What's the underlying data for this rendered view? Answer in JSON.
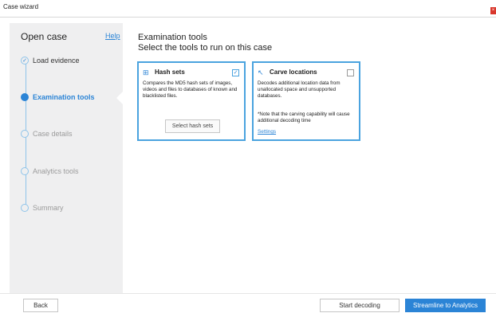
{
  "window": {
    "title": "Case wizard",
    "close_glyph": "×"
  },
  "sidebar": {
    "heading": "Open case",
    "help": "Help",
    "steps": [
      {
        "label": "Load evidence",
        "state": "done",
        "glyph": "✓"
      },
      {
        "label": "Examination tools",
        "state": "active",
        "glyph": ""
      },
      {
        "label": "Case details",
        "state": "pending",
        "glyph": ""
      },
      {
        "label": "Analytics tools",
        "state": "pending",
        "glyph": ""
      },
      {
        "label": "Summary",
        "state": "pending",
        "glyph": ""
      }
    ]
  },
  "main": {
    "title": "Examination tools",
    "subtitle": "Select the tools to run on this case",
    "cards": [
      {
        "title": "Hash sets",
        "icon": "hash-set-icon",
        "icon_glyph": "⊞",
        "checked": true,
        "check_glyph": "✓",
        "description": "Compares the MD5 hash sets of images, videos and files to databases of known and blacklisted files.",
        "button": "Select hash sets"
      },
      {
        "title": "Carve locations",
        "icon": "carve-locations-icon",
        "icon_glyph": "↖",
        "checked": false,
        "check_glyph": "",
        "description": "Decodes additional location data from unallocated space and unsupported databases.",
        "note": "*Note that the carving capability will cause additional decoding time",
        "link": "Settings"
      }
    ]
  },
  "footer": {
    "back": "Back",
    "start": "Start decoding",
    "primary": "Streamline to Analytics"
  },
  "colors": {
    "accent": "#2b84d6",
    "card_border": "#4aa3df",
    "sidebar_bg": "#efeff0",
    "close": "#d9372c"
  }
}
